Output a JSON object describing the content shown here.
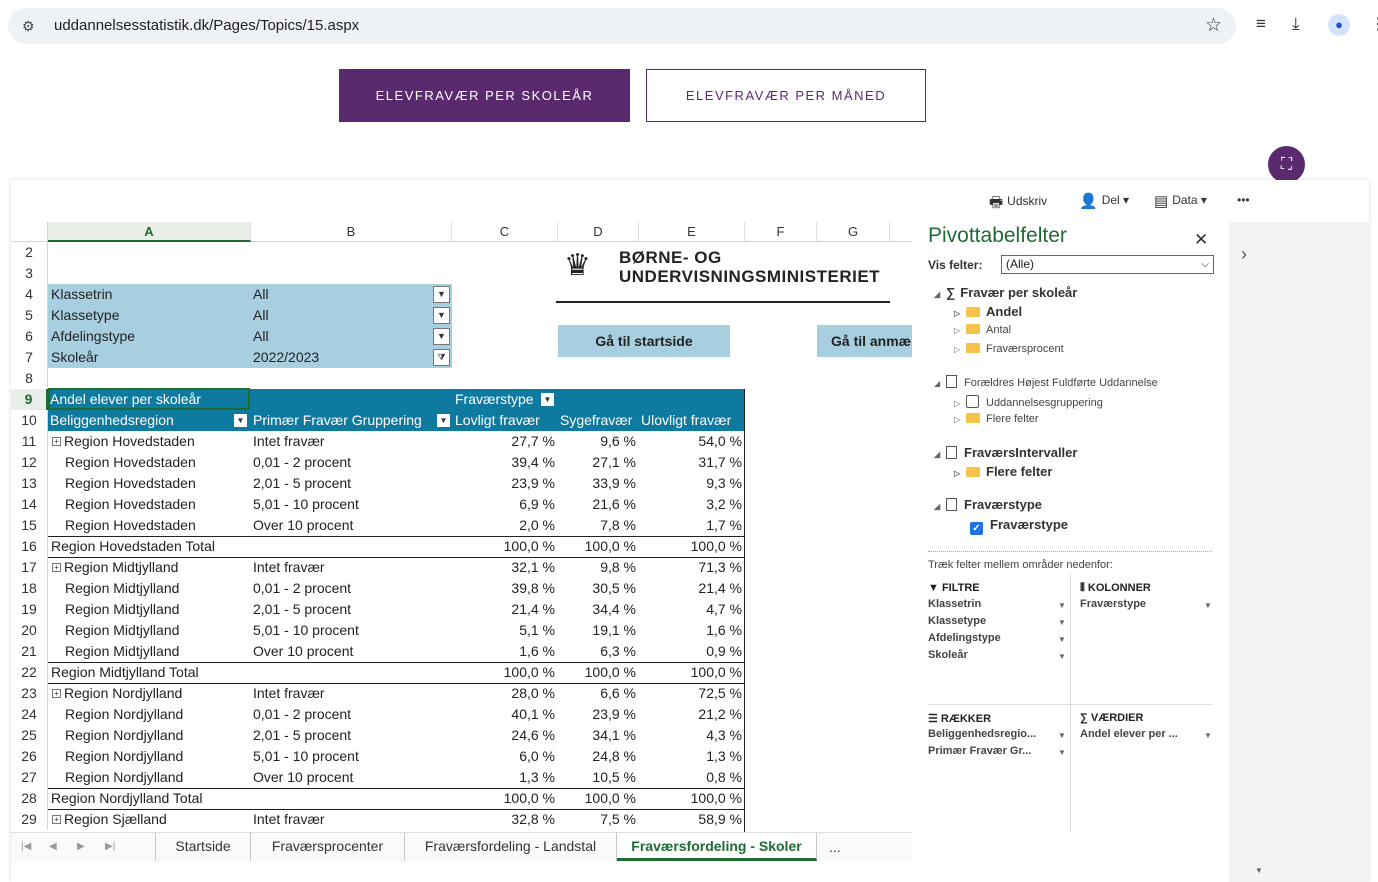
{
  "browser": {
    "url": "uddannelsesstatistik.dk/Pages/Topics/15.aspx"
  },
  "page": {
    "btn_skoleaar": "ELEVFRAVÆR PER SKOLEÅR",
    "btn_maaned": "ELEVFRAVÆR PER MÅNED"
  },
  "ribbon": {
    "print": "Udskriv",
    "share": "Del",
    "data": "Data",
    "more": "•••"
  },
  "grid": {
    "columns": [
      "A",
      "B",
      "C",
      "D",
      "E",
      "F",
      "G"
    ],
    "row_numbers": [
      "2",
      "3",
      "4",
      "5",
      "6",
      "7",
      "8",
      "9",
      "10",
      "11",
      "12",
      "13",
      "14",
      "15",
      "16",
      "17",
      "18",
      "19",
      "20",
      "21",
      "22",
      "23",
      "24",
      "25",
      "26",
      "27",
      "28",
      "29"
    ],
    "filters": [
      {
        "label": "Klassetrin",
        "value": "All"
      },
      {
        "label": "Klassetype",
        "value": "All"
      },
      {
        "label": "Afdelingstype",
        "value": "All"
      },
      {
        "label": "Skoleår",
        "value": "2022/2023"
      }
    ],
    "logo_line1": "BØRNE- OG",
    "logo_line2": "UNDERVISNINGSMINISTERIET",
    "btn_start": "Gå til startside",
    "btn_anm": "Gå til anmærkninger",
    "header1_label": "Andel elever per skoleår",
    "header1_fravaerstype": "Fraværstype",
    "header2": {
      "region": "Beliggenhedsregion",
      "gruppe": "Primær Fravær Gruppering",
      "lovligt": "Lovligt fravær",
      "syge": "Sygefravær",
      "ulovligt": "Ulovligt fravær"
    },
    "rows": [
      {
        "region": "Region Hovedstaden",
        "group": "Intet fravær",
        "c": "27,7 %",
        "d": "9,6 %",
        "e": "54,0 %",
        "first": true
      },
      {
        "region": "Region Hovedstaden",
        "group": "0,01 - 2 procent",
        "c": "39,4 %",
        "d": "27,1 %",
        "e": "31,7 %"
      },
      {
        "region": "Region Hovedstaden",
        "group": "2,01 - 5 procent",
        "c": "23,9 %",
        "d": "33,9 %",
        "e": "9,3 %"
      },
      {
        "region": "Region Hovedstaden",
        "group": "5,01 - 10 procent",
        "c": "6,9 %",
        "d": "21,6 %",
        "e": "3,2 %"
      },
      {
        "region": "Region Hovedstaden",
        "group": "Over 10 procent",
        "c": "2,0 %",
        "d": "7,8 %",
        "e": "1,7 %"
      },
      {
        "region": "Region Hovedstaden Total",
        "group": "",
        "c": "100,0 %",
        "d": "100,0 %",
        "e": "100,0 %",
        "total": true
      },
      {
        "region": "Region Midtjylland",
        "group": "Intet fravær",
        "c": "32,1 %",
        "d": "9,8 %",
        "e": "71,3 %",
        "first": true
      },
      {
        "region": "Region Midtjylland",
        "group": "0,01 - 2 procent",
        "c": "39,8 %",
        "d": "30,5 %",
        "e": "21,4 %"
      },
      {
        "region": "Region Midtjylland",
        "group": "2,01 - 5 procent",
        "c": "21,4 %",
        "d": "34,4 %",
        "e": "4,7 %"
      },
      {
        "region": "Region Midtjylland",
        "group": "5,01 - 10 procent",
        "c": "5,1 %",
        "d": "19,1 %",
        "e": "1,6 %"
      },
      {
        "region": "Region Midtjylland",
        "group": "Over 10 procent",
        "c": "1,6 %",
        "d": "6,3 %",
        "e": "0,9 %"
      },
      {
        "region": "Region Midtjylland Total",
        "group": "",
        "c": "100,0 %",
        "d": "100,0 %",
        "e": "100,0 %",
        "total": true
      },
      {
        "region": "Region Nordjylland",
        "group": "Intet fravær",
        "c": "28,0 %",
        "d": "6,6 %",
        "e": "72,5 %",
        "first": true
      },
      {
        "region": "Region Nordjylland",
        "group": "0,01 - 2 procent",
        "c": "40,1 %",
        "d": "23,9 %",
        "e": "21,2 %"
      },
      {
        "region": "Region Nordjylland",
        "group": "2,01 - 5 procent",
        "c": "24,6 %",
        "d": "34,1 %",
        "e": "4,3 %"
      },
      {
        "region": "Region Nordjylland",
        "group": "5,01 - 10 procent",
        "c": "6,0 %",
        "d": "24,8 %",
        "e": "1,3 %"
      },
      {
        "region": "Region Nordjylland",
        "group": "Over 10 procent",
        "c": "1,3 %",
        "d": "10,5 %",
        "e": "0,8 %"
      },
      {
        "region": "Region Nordjylland Total",
        "group": "",
        "c": "100,0 %",
        "d": "100,0 %",
        "e": "100,0 %",
        "total": true
      },
      {
        "region": "Region Sjælland",
        "group": "Intet fravær",
        "c": "32,8 %",
        "d": "7,5 %",
        "e": "58,9 %",
        "first": true
      }
    ]
  },
  "tabs": {
    "items": [
      "Startside",
      "Fraværsprocenter",
      "Fraværsfordeling - Landstal",
      "Fraværsfordeling - Skoler"
    ],
    "more": "..."
  },
  "pivot": {
    "title": "Pivottabelfelter",
    "show_label": "Vis felter:",
    "show_value": "(Alle)",
    "tree": {
      "fravaer_per_skoleaar": "Fravær per skoleår",
      "andel": "Andel",
      "antal": "Antal",
      "fravaersprocent": "Fraværsprocent",
      "foraeldre": "Forældres Højest Fuldførte Uddannelse",
      "uddannelsesgruppering": "Uddannelsesgruppering",
      "flere_felter_1": "Flere felter",
      "fravaersintervaller": "FraværsIntervaller",
      "flere_felter_2": "Flere felter",
      "fravaerstype_table": "Fraværstype",
      "fravaerstype_field": "Fraværstype"
    },
    "hint": "Træk felter mellem områder nedenfor:",
    "filtre_hdr": "FILTRE",
    "filtre": [
      "Klassetrin",
      "Klassetype",
      "Afdelingstype",
      "Skoleår"
    ],
    "kolonner_hdr": "KOLONNER",
    "kolonner": [
      "Fraværstype"
    ],
    "raekker_hdr": "RÆKKER",
    "raekker": [
      "Beliggenhedsregio...",
      "Primær Fravær Gr..."
    ],
    "vaerdier_hdr": "VÆRDIER",
    "vaerdier": [
      "Andel elever per ..."
    ]
  }
}
